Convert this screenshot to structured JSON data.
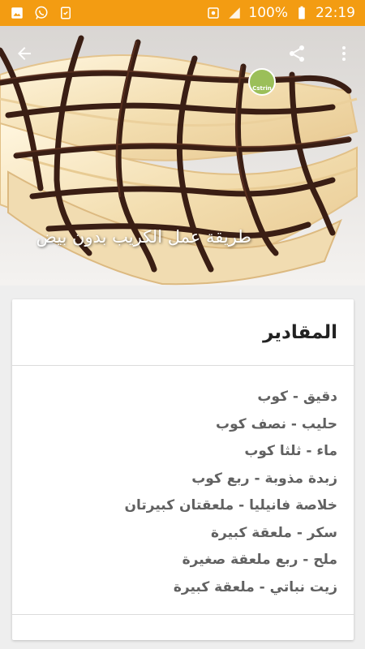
{
  "status_bar": {
    "battery_percent": "100%",
    "time": "22:19",
    "left_icons": [
      "gallery-icon",
      "whatsapp-icon",
      "sync-icon"
    ],
    "right_icons": [
      "alarm-icon",
      "signal-icon",
      "battery-icon"
    ],
    "color": "#f39c12"
  },
  "hero": {
    "title": "طريقة عمل الكريب بدون بيض",
    "badge_text": "Cstrin",
    "toolbar_icons": [
      "back-arrow-icon",
      "share-icon",
      "more-vert-icon"
    ]
  },
  "card": {
    "title": "المقادير",
    "ingredients": [
      "دقيق - كوب",
      "حليب - نصف كوب",
      "ماء - ثلثا كوب",
      "زبدة مذوبة - ربع كوب",
      "خلاصة فانيليا - ملعقتان كبيرتان",
      "سكر - ملعقة كبيرة",
      "ملح - ربع ملعقة صغيرة",
      "زيت نباتي - ملعقة كبيرة"
    ]
  }
}
